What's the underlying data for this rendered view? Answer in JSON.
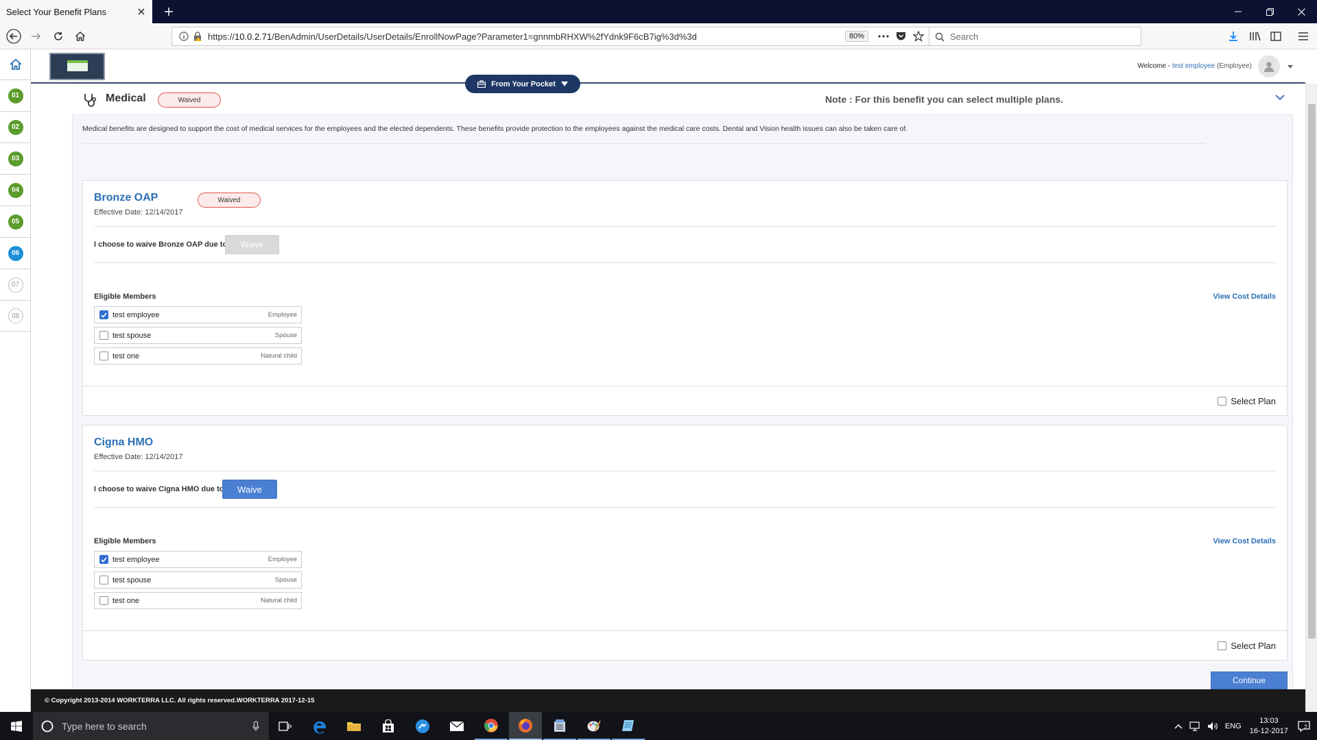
{
  "browser": {
    "tab_title": "Select Your Benefit Plans",
    "url_prefix": "https://",
    "url_host": "10.0.2.71",
    "url_path": "/BenAdmin/UserDetails/UserDetails/EnrollNowPage?Parameter1=gnnmbRHXW%2fYdnk9F6cB7ig%3d%3d",
    "zoom": "80%",
    "search_placeholder": "Search"
  },
  "header": {
    "welcome_prefix": "Welcome -",
    "user_name": "test employee",
    "user_role": "(Employee)",
    "pocket_label": "From Your Pocket"
  },
  "steps": [
    {
      "label": "01",
      "state": "done"
    },
    {
      "label": "02",
      "state": "done"
    },
    {
      "label": "03",
      "state": "done"
    },
    {
      "label": "04",
      "state": "done"
    },
    {
      "label": "05",
      "state": "done"
    },
    {
      "label": "06",
      "state": "active"
    },
    {
      "label": "07",
      "state": "todo"
    },
    {
      "label": "08",
      "state": "todo"
    }
  ],
  "benefit": {
    "title": "Medical",
    "status": "Waived",
    "note": "Note : For this benefit you can select multiple plans.",
    "description": "Medical benefits are designed to support the cost of medical services for the employees and the elected dependents. These benefits provide protection to the employees against the medical care costs. Dental and Vision health issues can also be taken care of."
  },
  "plans": [
    {
      "name": "Bronze OAP",
      "status": "Waived",
      "effective": "Effective Date: 12/14/2017",
      "waive_text": "I choose to waive Bronze OAP due to",
      "waive_button": "Waive",
      "eligible_label": "Eligible Members",
      "cost_link": "View Cost Details",
      "members": [
        {
          "name": "test employee",
          "relation": "Employee",
          "checked": true
        },
        {
          "name": "test spouse",
          "relation": "Spouse",
          "checked": false
        },
        {
          "name": "test one",
          "relation": "Natural child",
          "checked": false
        }
      ],
      "select_label": "Select Plan"
    },
    {
      "name": "Cigna HMO",
      "effective": "Effective Date: 12/14/2017",
      "waive_text": "I choose to waive Cigna HMO due to",
      "waive_button": "Waive",
      "eligible_label": "Eligible Members",
      "cost_link": "View Cost Details",
      "members": [
        {
          "name": "test employee",
          "relation": "Employee",
          "checked": true
        },
        {
          "name": "test spouse",
          "relation": "Spouse",
          "checked": false
        },
        {
          "name": "test one",
          "relation": "Natural child",
          "checked": false
        }
      ],
      "select_label": "Select Plan"
    }
  ],
  "continue_label": "Continue",
  "footer": "© Copyright 2013-2014 WORKTERRA LLC. All rights reserved.WORKTERRA 2017-12-15",
  "taskbar": {
    "search_placeholder": "Type here to search",
    "language": "ENG",
    "time": "13:03",
    "date": "16-12-2017",
    "notification_count": "2"
  },
  "colors": {
    "step_done": "#5b9c2c",
    "step_active": "#1a8fd6",
    "link_blue": "#2a6fb5",
    "button_blue": "#4a7fd3",
    "header_navy": "#1e3866",
    "waived_red": "#e0534f"
  }
}
